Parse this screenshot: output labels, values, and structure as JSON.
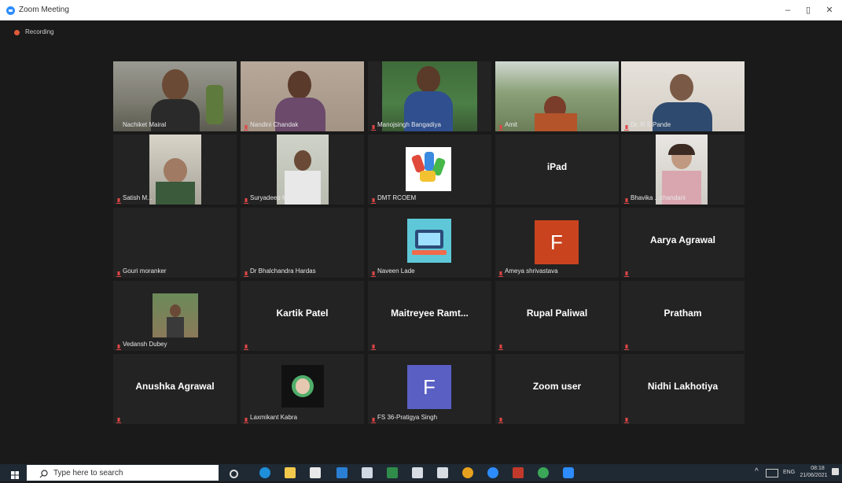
{
  "window": {
    "title": "Zoom Meeting",
    "minimize": "–",
    "restore": "▯",
    "close": "✕"
  },
  "recording": {
    "label": "Recording"
  },
  "participants": {
    "r1": [
      "Nachiket Mairal",
      "Nandini Chandak",
      "Manojsingh Bangadiya",
      "Amit",
      "Dr. R S Pande"
    ],
    "r2": [
      "Satish M...",
      "Suryadeep Manoj Sah...",
      "DMT RCOEM",
      "iPad",
      "Bhavika ...chandani"
    ],
    "r3": [
      "Gouri moranker",
      "Dr Bhalchandra Hardas",
      "Naveen Lade",
      "Ameya shrivastava",
      "Aarya Agrawal"
    ],
    "r4": [
      "Vedansh Dubey",
      "Kartik Patel",
      "Maitreyee  Ramt...",
      "Rupal Paliwal",
      "Pratham"
    ],
    "r5": [
      "Anushka Agrawal",
      "Laxmikant Kabra",
      "FS 36-Pratigya Singh",
      "Zoom user",
      "Nidhi Lakhotiya"
    ]
  },
  "avatars": {
    "ameya_letter": "F",
    "pratigya_letter": "F",
    "ameya_color": "#c8431e",
    "pratigya_color": "#5a5fc4"
  },
  "taskbar": {
    "search_placeholder": "Type here to search",
    "lang": "ENG",
    "time": "08:18",
    "date": "21/06/2021"
  }
}
